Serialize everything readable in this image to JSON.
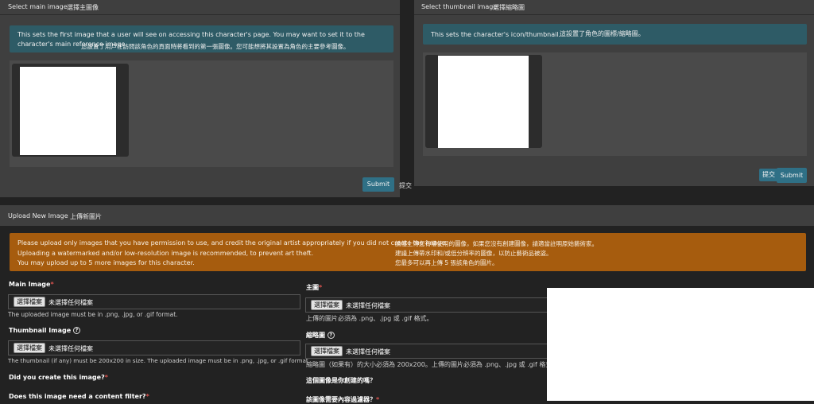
{
  "main_panel": {
    "title": "Select main image",
    "title_zh": "選擇主圖像",
    "info": "This sets the first image that a user will see on accessing this character's page. You may want to set it to the character's main reference image.",
    "info_zh": "這設置了用戶在訪問該角色的頁面時將看到的第一張圖像。您可能想將其設置為角色的主要參考圖像。",
    "submit": "Submit",
    "submit_zh": "提交"
  },
  "thumb_panel": {
    "title": "Select thumbnail image",
    "title_zh": "選擇縮略圖",
    "info": "This sets the character's icon/thumbnail.",
    "info_zh": "這設置了角色的圖標/縮略圖。",
    "submit": "Submit",
    "submit_zh": "提交"
  },
  "upload": {
    "title": "Upload New Image",
    "title_zh": "上傳新圖片",
    "notice": [
      "Please upload only images that you have permission to use, and credit the original artist appropriately if you did not create the image.",
      "Uploading a watermarked and/or low-resolution image is recommended, to prevent art theft.",
      "You may upload up to 5 more images for this character."
    ],
    "notice_zh": [
      "請僅上傳您有權使用的圖像，如果您沒有創建圖像，請適當註明原始藝術家。",
      "建議上傳帶水印和/或低分辨率的圖像，以防止藝術品被盜。",
      "您最多可以再上傳 5 張該角色的圖片。"
    ],
    "main_image": {
      "label": "Main Image",
      "label_zh": "主圖",
      "choose": "選擇檔案",
      "none": "未選擇任何檔案",
      "help": "The uploaded image must be in .png, .jpg, or .gif format.",
      "help_zh": "上傳的圖片必須為 .png、.jpg 或 .gif 格式。"
    },
    "thumbnail_image": {
      "label": "Thumbnail Image",
      "label_zh": "縮略圖",
      "choose": "選擇檔案",
      "none": "未選擇任何檔案",
      "help": "The thumbnail (if any) must be 200x200 in size. The uploaded image must be in .png, .jpg, or .gif format.",
      "help_zh": "縮略圖（如果有）的大小必須為 200x200。上傳的圖片必須為 .png、.jpg 或 .gif 格式。"
    },
    "q_created": "Did you create this image?",
    "q_created_zh": "這個圖像是你創建的嗎？",
    "q_filter": "Does this image need a content filter?",
    "q_filter_zh": "該圖像需要內容過濾器？",
    "req_mark": "*",
    "help_icon": "?"
  },
  "colors": {
    "info_teal": "#2e5b66",
    "notice_orange": "#a65c0e",
    "button": "#2f7086"
  }
}
